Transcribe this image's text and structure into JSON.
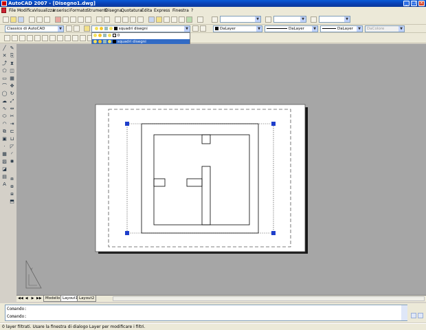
{
  "window": {
    "title": "AutoCAD 2007 - [Disegno1.dwg]",
    "minimize": "_",
    "restore": "❐",
    "close": "✕"
  },
  "menu": [
    "File",
    "Modifica",
    "Visualizza",
    "Inserisci",
    "Formato",
    "Strumenti",
    "Disegna",
    "Quotatura",
    "Edita",
    "Express",
    "Finestra",
    "?"
  ],
  "toolbar": {
    "workspace": "Classico di AutoCAD",
    "current_layer": "squadri disegni",
    "color": "DaLayer",
    "linetype": "DaLayer",
    "lineweight": "DaLayer",
    "plotstyle": "DaColore"
  },
  "layer_dropdown": {
    "items": [
      {
        "name": "0",
        "selected": false
      },
      {
        "name": "squadri disegni",
        "selected": true
      }
    ]
  },
  "layout_tabs": [
    {
      "label": "Modello",
      "active": false
    },
    {
      "label": "Layout1",
      "active": true
    },
    {
      "label": "Layout2",
      "active": false
    }
  ],
  "command": {
    "history": [
      "Comando: ",
      "Comando: "
    ]
  },
  "status": {
    "text": "0 layer filtrati. Usare la finestra di dialogo Layer per modificare i filtri."
  },
  "colors": {
    "model_space": "#a6a6a6",
    "selection_grip": "#1e3ecb"
  },
  "ucs": {
    "y_axis_label": "Y"
  }
}
